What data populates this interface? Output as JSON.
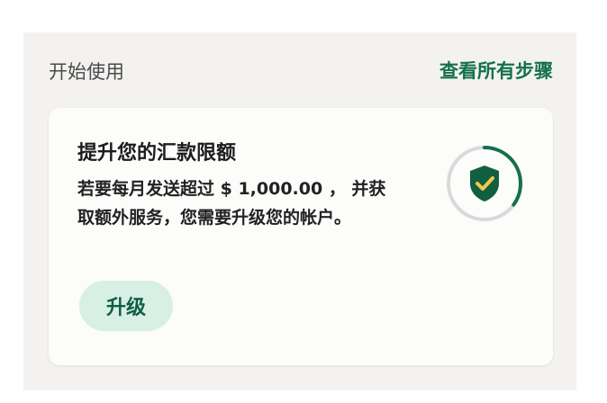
{
  "header": {
    "title": "开始使用",
    "view_all_label": "查看所有步骤"
  },
  "card": {
    "title": "提升您的汇款限额",
    "description": "若要每月发送超过 $ 1,000.00 ， 并获取额外服务，您需要升级您的帐户。",
    "button_label": "升级",
    "status_icon": "shield-check-icon",
    "progress_fraction": 0.35
  },
  "colors": {
    "accent": "#14704f",
    "button_bg": "#d8efe6",
    "shield": "#10603f",
    "progress_track": "#d9d9d9"
  }
}
